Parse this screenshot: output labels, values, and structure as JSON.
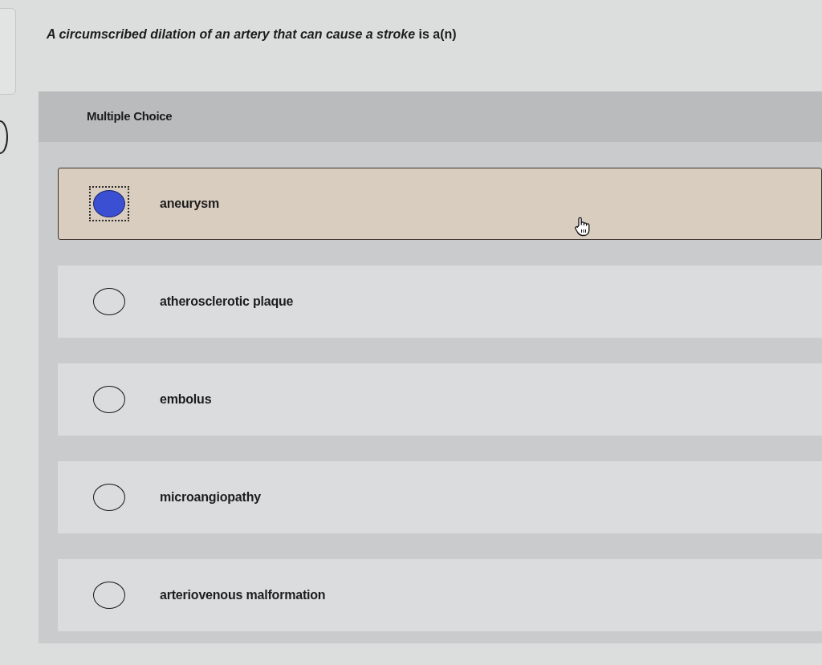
{
  "question": "*A circumscribed dilation of an artery that can cause a stroke* is a(n)",
  "question_type": "Multiple Choice",
  "options": [
    {
      "label": "aneurysm",
      "selected": true,
      "hovered": true
    },
    {
      "label": "atherosclerotic plaque",
      "selected": false,
      "hovered": false
    },
    {
      "label": "embolus",
      "selected": false,
      "hovered": false
    },
    {
      "label": "microangiopathy",
      "selected": false,
      "hovered": false
    },
    {
      "label": "arteriovenous malformation",
      "selected": false,
      "hovered": false
    }
  ]
}
